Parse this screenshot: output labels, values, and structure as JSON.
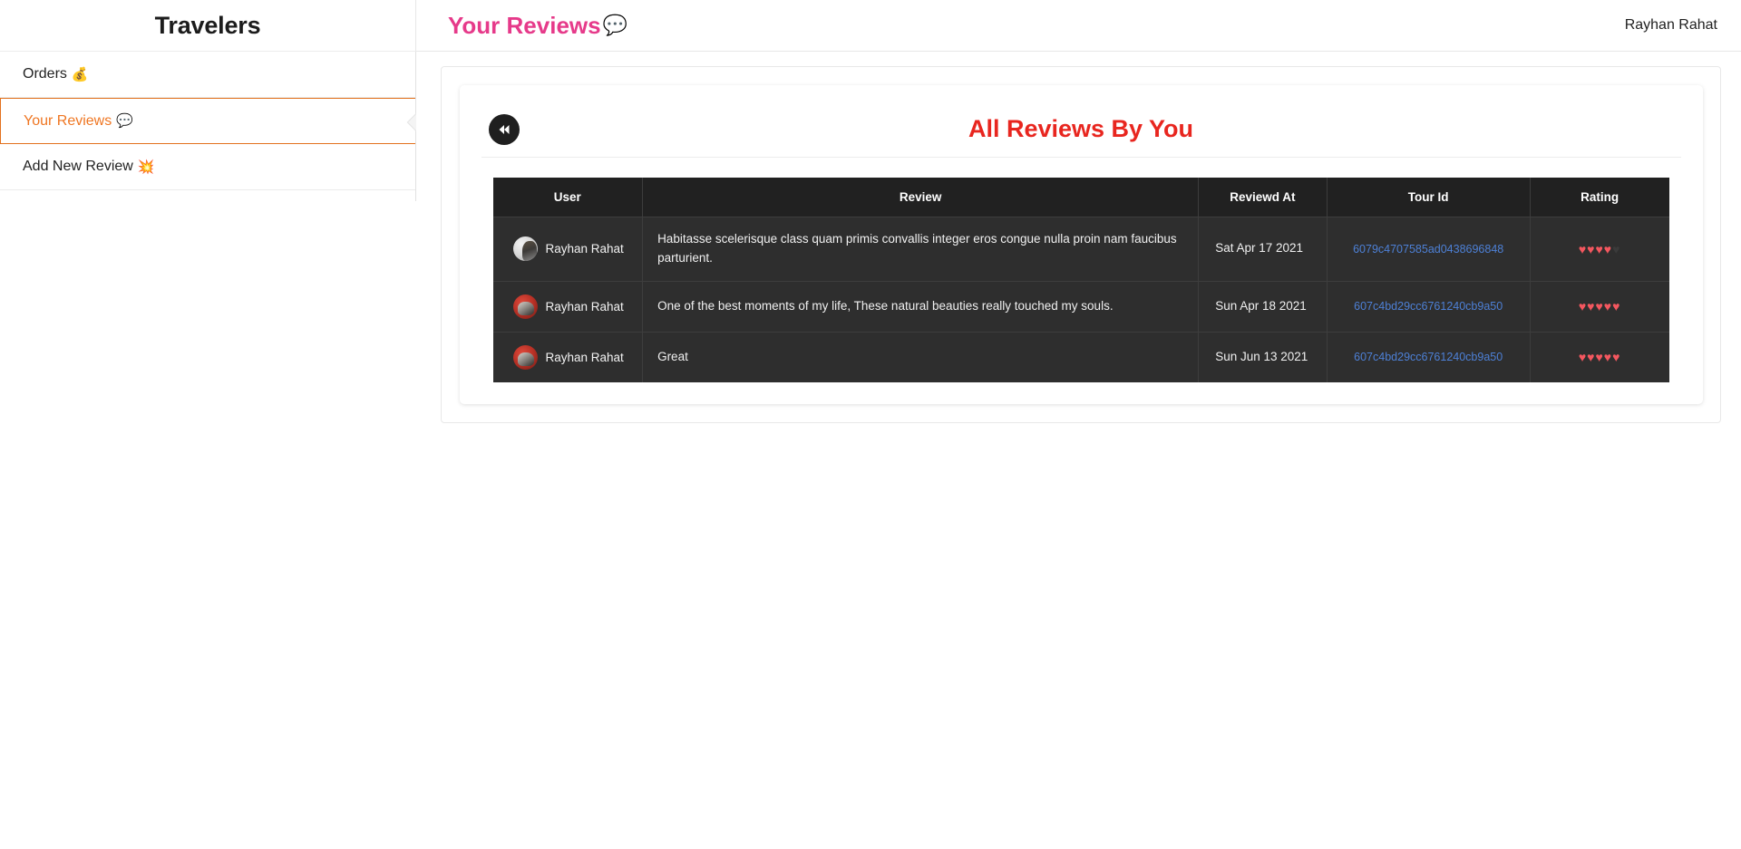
{
  "brand": {
    "title": "Travelers"
  },
  "header": {
    "page_title": "Your Reviews",
    "page_title_emoji": "💬",
    "user_name": "Rayhan Rahat"
  },
  "sidebar": {
    "items": [
      {
        "label": "Orders",
        "emoji": "💰",
        "active": false
      },
      {
        "label": "Your Reviews",
        "emoji": "💬",
        "active": true
      },
      {
        "label": "Add New Review",
        "emoji": "💥",
        "active": false
      }
    ]
  },
  "main": {
    "back_button_icon": "double-chevron-left",
    "back_button_glyph": "◀◀",
    "card_title": "All Reviews By You",
    "table": {
      "columns": [
        "User",
        "Review",
        "Reviewd At",
        "Tour Id",
        "Rating"
      ],
      "rows": [
        {
          "user": "Rayhan Rahat",
          "avatar": "light",
          "review": "Habitasse scelerisque class quam primis convallis integer eros congue nulla proin nam faucibus parturient.",
          "reviewed_at": "Sat Apr 17 2021",
          "tour_id": "6079c4707585ad0438696848",
          "rating": 4,
          "rating_max": 5
        },
        {
          "user": "Rayhan Rahat",
          "avatar": "red",
          "review": "One of the best moments of my life, These natural beauties really touched my souls.",
          "reviewed_at": "Sun Apr 18 2021",
          "tour_id": "607c4bd29cc6761240cb9a50",
          "rating": 5,
          "rating_max": 5
        },
        {
          "user": "Rayhan Rahat",
          "avatar": "red",
          "review": "Great",
          "reviewed_at": "Sun Jun 13 2021",
          "tour_id": "607c4bd29cc6761240cb9a50",
          "rating": 5,
          "rating_max": 5
        }
      ]
    }
  },
  "colors": {
    "brand_pink": "#e63a8a",
    "accent_orange": "#ef7622",
    "title_red": "#e8261f",
    "table_bg": "#2e2e2e",
    "table_header_bg": "#212121",
    "link_blue": "#4d80d6",
    "heart_on": "#f4575f",
    "heart_off": "#3a3a3a"
  }
}
